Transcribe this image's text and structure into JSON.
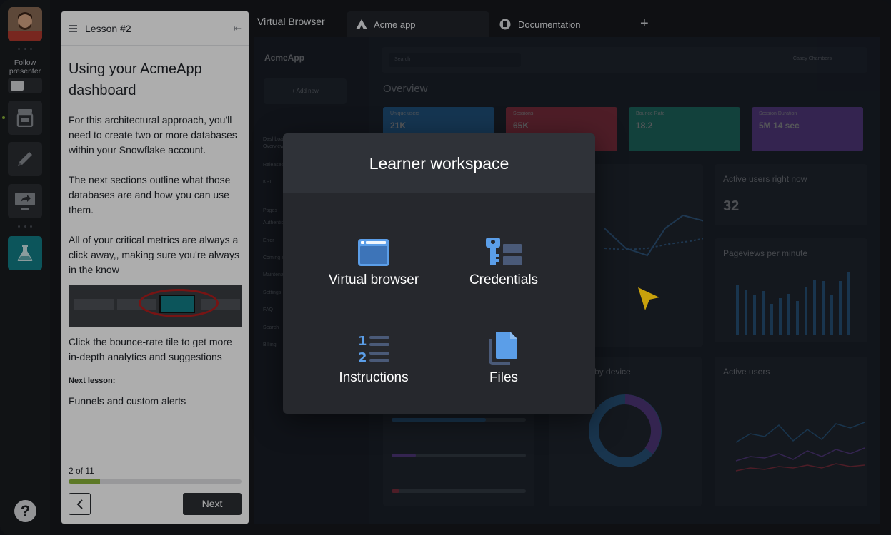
{
  "rail": {
    "follow_label": "Follow presenter"
  },
  "lesson": {
    "header_title": "Lesson #2",
    "heading": "Using your AcmeApp dashboard",
    "paragraphs": [
      "For this architectural approach, you'll need to create two or more databases within your Snowflake account.",
      "The next sections outline what those databases are and how you can use them.",
      "All of your critical metrics are always a click away,, making sure you're always in the know"
    ],
    "caption": "Click the bounce-rate tile to get more in-depth analytics and suggestions",
    "next_lesson_label": "Next lesson:",
    "next_lesson_title": "Funnels and custom alerts",
    "progress_text": "2 of 11",
    "progress_fraction": 0.1818,
    "next_button": "Next"
  },
  "browser": {
    "title": "Virtual Browser",
    "tabs": [
      {
        "label": "Acme app",
        "active": true
      },
      {
        "label": "Documentation",
        "active": false
      }
    ]
  },
  "app": {
    "logo": "AcmeApp",
    "add_new": "+ Add new",
    "nav": [
      "Dashboard",
      "Overview",
      "Releases",
      "KPI",
      "Pages",
      "Authentication",
      "Error",
      "Coming soon",
      "Maintenance",
      "Settings",
      "FAQ",
      "Search",
      "Billing"
    ],
    "search_placeholder": "Search",
    "user_name": "Casey Chambers",
    "overview": "Overview",
    "kpis": [
      {
        "label": "Unique users",
        "value": "21K",
        "color": "#1e88e5"
      },
      {
        "label": "Sessions",
        "value": "65K",
        "color": "#e53950"
      },
      {
        "label": "Bounce Rate",
        "value": "18.2",
        "color": "#14b39a"
      },
      {
        "label": "Session Duration",
        "value": "5M 14 sec",
        "color": "#8a4fe0"
      }
    ],
    "cards": {
      "active_now": "Active users right now",
      "active_now_value": "32",
      "pageviews": "Pageviews per minute",
      "sessions_device": "Sessions by device",
      "active_users": "Active users"
    }
  },
  "modal": {
    "title": "Learner workspace",
    "options": [
      {
        "label": "Virtual browser",
        "icon": "browser-window-icon"
      },
      {
        "label": "Credentials",
        "icon": "key-card-icon"
      },
      {
        "label": "Instructions",
        "icon": "numbered-list-icon"
      },
      {
        "label": "Files",
        "icon": "files-icon"
      }
    ]
  },
  "colors": {
    "accent": "#127e86",
    "icon_blue": "#5b9ee8",
    "progress": "#8ab33a",
    "cursor": "#c8a10c"
  }
}
